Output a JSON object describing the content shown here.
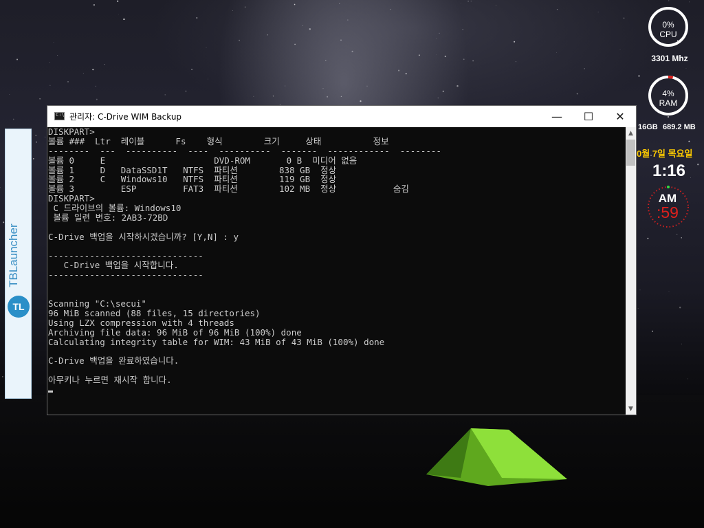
{
  "window": {
    "title": "관리자:  C-Drive WIM Backup",
    "minimize": "—",
    "maximize": "☐",
    "close": "✕"
  },
  "console_lines": [
    "DISKPART>",
    "볼륨 ###  Ltr  레이블      Fs    형식        크기     상태          정보",
    "--------  ---  ----------  ----  ----------  -------  ------------  --------",
    "볼륨 0     E                     DVD-ROM       0 B  미디어 없음",
    "볼륨 1     D   DataSSD1T   NTFS  파티션        838 GB  정상",
    "볼륨 2     C   Windows10   NTFS  파티션        119 GB  정상",
    "볼륨 3         ESP         FAT3  파티션        102 MB  정상           숨김",
    "DISKPART>",
    " C 드라이브의 볼륨: Windows10",
    " 볼륨 일련 번호: 2AB3-72BD",
    "",
    "C-Drive 백업을 시작하시겠습니까? [Y,N] : y",
    "",
    "------------------------------",
    "   C-Drive 백업을 시작합니다.",
    "------------------------------",
    "",
    "",
    "Scanning \"C:\\secui\"",
    "96 MiB scanned (88 files, 15 directories)",
    "Using LZX compression with 4 threads",
    "Archiving file data: 96 MiB of 96 MiB (100%) done",
    "Calculating integrity table for WIM: 43 MiB of 43 MiB (100%) done",
    "",
    "C-Drive 백업을 완료하였습니다.",
    "",
    "아무키나 누르면 재시작 합니다."
  ],
  "launcher": {
    "label": "TBLauncher",
    "logo": "TL"
  },
  "gadgets": {
    "cpu_percent": "0%",
    "cpu_label": "CPU",
    "cpu_level": 0,
    "cpu_freq": "3301 Mhz",
    "ram_percent": "4%",
    "ram_label": "RAM",
    "ram_level": 4,
    "ram_total": "16GB",
    "ram_used": "689.2 MB",
    "date": "0월 7일 목요일",
    "time": "1:16",
    "ampm": "AM",
    "seconds": ":59"
  },
  "colors": {
    "console_bg": "#0c0c0c",
    "console_fg": "#cccccc",
    "ring_red": "#e0201c",
    "date_yellow": "#ffcc00",
    "seconds_red": "#e0201c"
  }
}
